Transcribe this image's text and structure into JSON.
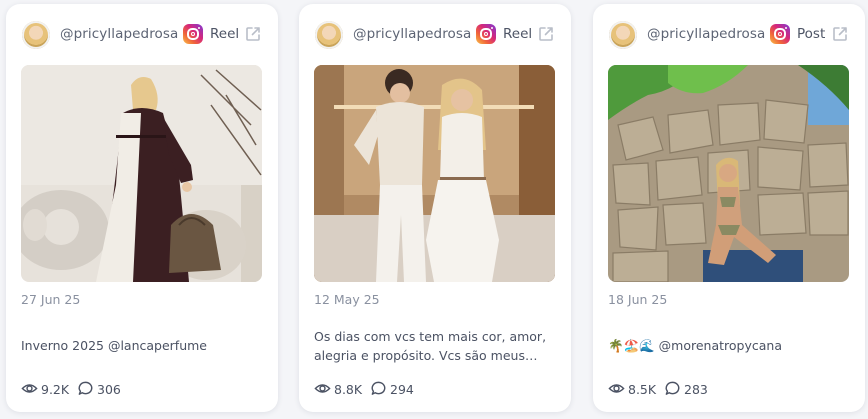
{
  "posts": [
    {
      "handle": "@pricyllapedrosa",
      "type": "Reel",
      "date": "27 Jun 25",
      "caption": "Inverno 2025 @lancaperfume",
      "views": "9.2K",
      "comments": "306",
      "image_description": "woman in long dark and white dress holding handbag in living room"
    },
    {
      "handle": "@pricyllapedrosa",
      "type": "Reel",
      "date": "12 May 25",
      "caption": "Os dias com vcs tem mais cor, amor, alegria e propósito. Vcs são meus…",
      "views": "8.8K",
      "comments": "294",
      "image_description": "woman and young man in white outfits posing indoors"
    },
    {
      "handle": "@pricyllapedrosa",
      "type": "Post",
      "date": "18 Jun 25",
      "caption": "🌴🏖️🌊 @morenatropycana",
      "views": "8.5K",
      "comments": "283",
      "image_description": "woman in bikini sitting by stone wall with palm leaves"
    }
  ],
  "icons": {
    "views": "eye-icon",
    "comments": "comment-bubble-icon",
    "external": "external-link-icon",
    "platform": "instagram-icon"
  },
  "colors": {
    "background": "#f4f5f8",
    "card": "#ffffff",
    "text": "#4b5263",
    "muted": "#8a91a0"
  }
}
